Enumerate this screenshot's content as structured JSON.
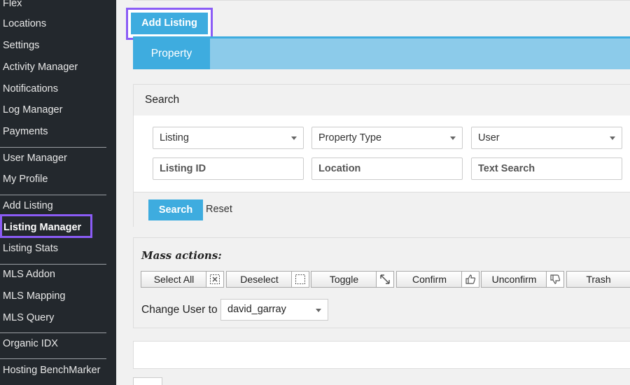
{
  "sidebar": {
    "items": [
      {
        "label": "Flex"
      },
      {
        "label": "Locations"
      },
      {
        "label": "Settings"
      },
      {
        "label": "Activity Manager"
      },
      {
        "label": "Notifications"
      },
      {
        "label": "Log Manager"
      },
      {
        "label": "Payments"
      },
      {
        "label": "User Manager"
      },
      {
        "label": "My Profile"
      },
      {
        "label": "Add Listing"
      },
      {
        "label": "Listing Manager"
      },
      {
        "label": "Listing Stats"
      },
      {
        "label": "MLS Addon"
      },
      {
        "label": "MLS Mapping"
      },
      {
        "label": "MLS Query"
      },
      {
        "label": "Organic IDX"
      },
      {
        "label": "Hosting BenchMarker"
      }
    ]
  },
  "header": {
    "add_listing_label": "Add Listing"
  },
  "tabs": [
    {
      "label": "Property"
    }
  ],
  "search": {
    "title": "Search",
    "listing_select": "Listing",
    "property_type_select": "Property Type",
    "user_select": "User",
    "listing_id_placeholder": "Listing ID",
    "location_placeholder": "Location",
    "text_search_placeholder": "Text Search",
    "search_button": "Search",
    "reset_link": "Reset"
  },
  "mass_actions": {
    "title": "Mass actions:",
    "buttons": [
      {
        "label": "Select All",
        "icon": "select-all-icon"
      },
      {
        "label": "Deselect",
        "icon": "deselect-icon"
      },
      {
        "label": "Toggle",
        "icon": "toggle-icon"
      },
      {
        "label": "Confirm",
        "icon": "thumbs-up-icon"
      },
      {
        "label": "Unconfirm",
        "icon": "thumbs-down-icon"
      },
      {
        "label": "Trash",
        "icon": "trash-icon"
      }
    ],
    "change_user_label": "Change User to",
    "change_user_value": "david_garray"
  },
  "colors": {
    "accent": "#3eacdf",
    "tab_bar": "#8ccbea",
    "highlight": "#8b5cf6",
    "sidebar_bg": "#23282d"
  }
}
